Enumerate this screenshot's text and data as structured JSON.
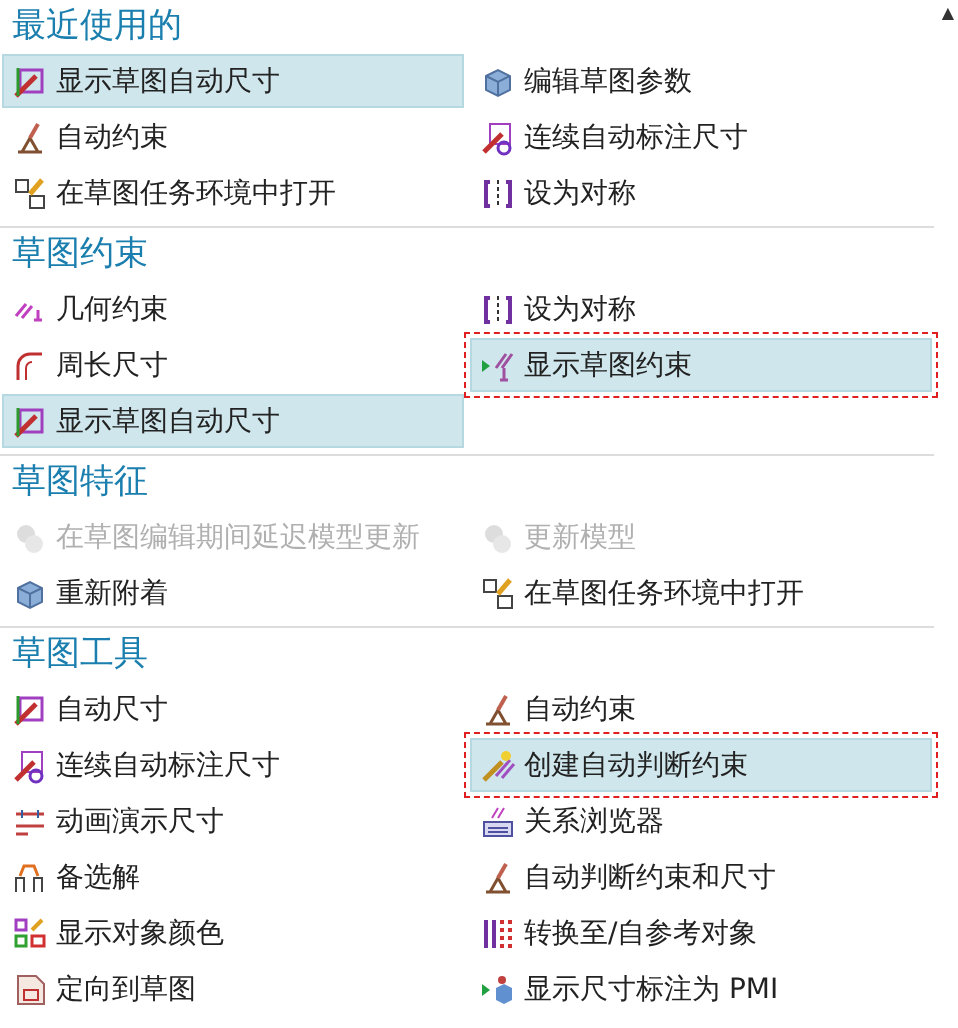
{
  "scroll_arrow": "▲",
  "sections": [
    {
      "title": "最近使用的",
      "items": [
        {
          "label": "显示草图自动尺寸",
          "selected": true,
          "disabled": false,
          "annotated": false
        },
        {
          "label": "编辑草图参数",
          "selected": false,
          "disabled": false,
          "annotated": false
        },
        {
          "label": "自动约束",
          "selected": false,
          "disabled": false,
          "annotated": false
        },
        {
          "label": "连续自动标注尺寸",
          "selected": false,
          "disabled": false,
          "annotated": false
        },
        {
          "label": "在草图任务环境中打开",
          "selected": false,
          "disabled": false,
          "annotated": false
        },
        {
          "label": "设为对称",
          "selected": false,
          "disabled": false,
          "annotated": false
        }
      ]
    },
    {
      "title": "草图约束",
      "items": [
        {
          "label": "几何约束",
          "selected": false,
          "disabled": false,
          "annotated": false
        },
        {
          "label": "设为对称",
          "selected": false,
          "disabled": false,
          "annotated": false
        },
        {
          "label": "周长尺寸",
          "selected": false,
          "disabled": false,
          "annotated": false
        },
        {
          "label": "显示草图约束",
          "selected": true,
          "disabled": false,
          "annotated": true
        },
        {
          "label": "显示草图自动尺寸",
          "selected": true,
          "disabled": false,
          "annotated": false
        }
      ]
    },
    {
      "title": "草图特征",
      "items": [
        {
          "label": "在草图编辑期间延迟模型更新",
          "selected": false,
          "disabled": true,
          "annotated": false
        },
        {
          "label": "更新模型",
          "selected": false,
          "disabled": true,
          "annotated": false
        },
        {
          "label": "重新附着",
          "selected": false,
          "disabled": false,
          "annotated": false
        },
        {
          "label": "在草图任务环境中打开",
          "selected": false,
          "disabled": false,
          "annotated": false
        }
      ]
    },
    {
      "title": "草图工具",
      "items": [
        {
          "label": "自动尺寸",
          "selected": false,
          "disabled": false,
          "annotated": false
        },
        {
          "label": "自动约束",
          "selected": false,
          "disabled": false,
          "annotated": false
        },
        {
          "label": "连续自动标注尺寸",
          "selected": false,
          "disabled": false,
          "annotated": false
        },
        {
          "label": "创建自动判断约束",
          "selected": true,
          "disabled": false,
          "annotated": true
        },
        {
          "label": "动画演示尺寸",
          "selected": false,
          "disabled": false,
          "annotated": false
        },
        {
          "label": "关系浏览器",
          "selected": false,
          "disabled": false,
          "annotated": false
        },
        {
          "label": "备选解",
          "selected": false,
          "disabled": false,
          "annotated": false
        },
        {
          "label": "自动判断约束和尺寸",
          "selected": false,
          "disabled": false,
          "annotated": false
        },
        {
          "label": "显示对象颜色",
          "selected": false,
          "disabled": false,
          "annotated": false
        },
        {
          "label": "转换至/自参考对象",
          "selected": false,
          "disabled": false,
          "annotated": false
        },
        {
          "label": "定向到草图",
          "selected": false,
          "disabled": false,
          "annotated": false
        },
        {
          "label": "显示尺寸标注为 PMI",
          "selected": false,
          "disabled": false,
          "annotated": false
        }
      ]
    }
  ]
}
